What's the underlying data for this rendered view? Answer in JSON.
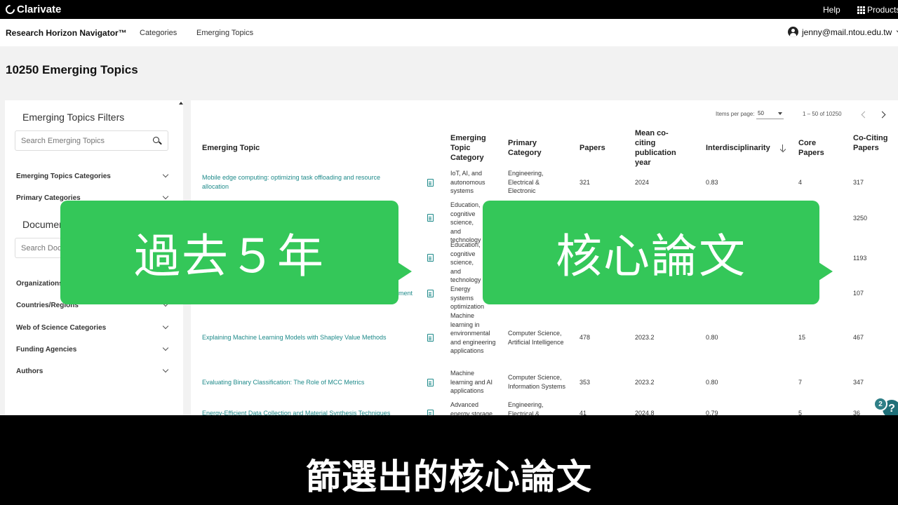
{
  "topbar": {
    "brand": "Clarivate",
    "help": "Help",
    "products": "Products"
  },
  "navbar": {
    "app_name": "Research Horizon Navigator™",
    "links": [
      "Categories",
      "Emerging Topics"
    ],
    "user_email": "jenny@mail.ntou.edu.tw"
  },
  "page_title": "10250 Emerging Topics",
  "filters": {
    "title": "Emerging Topics Filters",
    "search_placeholder": "Search Emerging Topics",
    "items": [
      "Emerging Topics Categories",
      "Primary Categories"
    ],
    "documents_title": "Documents",
    "documents_search_placeholder": "Search Documents",
    "more_items": [
      "Organizations",
      "Countries/Regions",
      "Web of Science Categories",
      "Funding Agencies",
      "Authors"
    ]
  },
  "pager": {
    "label": "Items per page:",
    "value": "50",
    "range": "1 – 50 of 10250"
  },
  "table": {
    "headers": [
      "Emerging Topic",
      "Emerging Topic Category",
      "Primary Category",
      "Papers",
      "Mean co-citing publication year",
      "Interdisciplinarity",
      "Core Papers",
      "Co-Citing Papers"
    ],
    "rows": [
      {
        "topic": "Mobile edge computing: optimizing task offloading and resource allocation",
        "category": "IoT, AI, and autonomous systems",
        "primary": "Engineering, Electrical & Electronic",
        "papers": "321",
        "year": "2024",
        "inter": "0.83",
        "core": "4",
        "cociting": "317"
      },
      {
        "topic": "",
        "category": "Education, cognitive science, and technology",
        "primary": "",
        "papers": "",
        "year": "",
        "inter": "",
        "core": "",
        "cociting": "3250"
      },
      {
        "topic": "",
        "category": "Education, cognitive science, and technology",
        "primary": "",
        "papers": "",
        "year": "",
        "inter": "",
        "core": "",
        "cociting": "1193"
      },
      {
        "topic": "ment",
        "category": "Energy systems optimization",
        "primary": "",
        "papers": "",
        "year": "",
        "inter": "",
        "core": "",
        "cociting": "107"
      },
      {
        "topic": "Explaining Machine Learning Models with Shapley Value Methods",
        "category": "Machine learning in environmental and engineering applications",
        "primary": "Computer Science, Artificial Intelligence",
        "papers": "478",
        "year": "2023.2",
        "inter": "0.80",
        "core": "15",
        "cociting": "467"
      },
      {
        "topic": "Evaluating Binary Classification: The Role of MCC Metrics",
        "category": "Machine learning and AI applications",
        "primary": "Computer Science, Information Systems",
        "papers": "353",
        "year": "2023.2",
        "inter": "0.80",
        "core": "7",
        "cociting": "347"
      },
      {
        "topic": "Energy-Efficient Data Collection and Material Synthesis Techniques",
        "category": "Advanced energy storage",
        "primary": "Engineering, Electrical &",
        "papers": "41",
        "year": "2024.8",
        "inter": "0.79",
        "core": "5",
        "cociting": "36"
      }
    ]
  },
  "overlays": {
    "callout_left": "過去５年",
    "callout_right": "核心論文",
    "subtitle": "篩選出的核心論文"
  },
  "badges": {
    "small": "2",
    "large": "?"
  }
}
